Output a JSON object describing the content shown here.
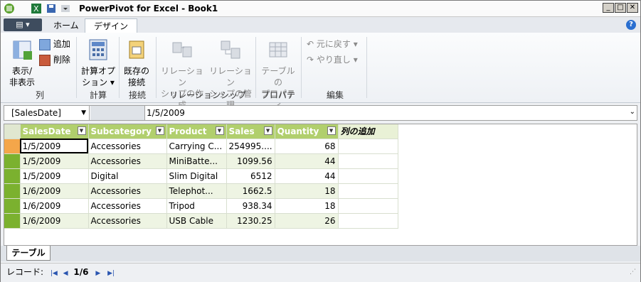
{
  "window": {
    "title": "PowerPivot for Excel - Book1"
  },
  "tabs": {
    "home": "ホーム",
    "design": "デザイン"
  },
  "ribbon": {
    "show_hide": [
      "表示/",
      "非表示"
    ],
    "add": "追加",
    "delete": "削除",
    "calc_options": [
      "計算オプ",
      "ション ▾"
    ],
    "existing_conn": [
      "既存の",
      "接続"
    ],
    "create_rel": [
      "リレーション",
      "シップの作成"
    ],
    "manage_rel": [
      "リレーション",
      "シップの管理"
    ],
    "table_props": [
      "テーブルの",
      "プロパティ"
    ],
    "undo": "元に戻す ▾",
    "redo": "やり直し ▾",
    "groups": {
      "columns": "列",
      "calc": "計算",
      "conn": "接続",
      "rel": "リレーションシップ",
      "props": "プロパティ",
      "edit": "編集"
    }
  },
  "formula": {
    "name": "[SalesDate]",
    "value": "1/5/2009"
  },
  "table": {
    "columns": [
      "SalesDate",
      "Subcategory",
      "Product",
      "Sales",
      "Quantity"
    ],
    "add_column": "列の追加",
    "rows": [
      [
        "1/5/2009",
        "Accessories",
        "Carrying C...",
        "254995....",
        "68"
      ],
      [
        "1/5/2009",
        "Accessories",
        "MiniBatte...",
        "1099.56",
        "44"
      ],
      [
        "1/5/2009",
        "Digital",
        "Slim Digital",
        "6512",
        "44"
      ],
      [
        "1/6/2009",
        "Accessories",
        "Telephot...",
        "1662.5",
        "18"
      ],
      [
        "1/6/2009",
        "Accessories",
        "Tripod",
        "938.34",
        "18"
      ],
      [
        "1/6/2009",
        "Accessories",
        "USB Cable",
        "1230.25",
        "26"
      ]
    ]
  },
  "sheet_tab": "テーブル",
  "status": {
    "record_label": "レコード:",
    "position": "1/6"
  },
  "colors": {
    "header": "#b1cf6d",
    "row_header": "#7bb12f",
    "current_row": "#f4a64a"
  }
}
